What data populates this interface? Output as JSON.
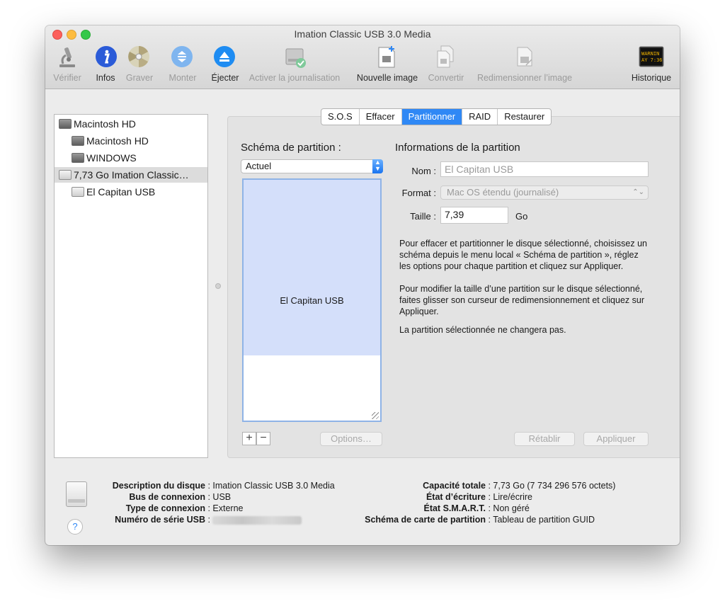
{
  "window": {
    "title": "Imation Classic USB 3.0 Media"
  },
  "toolbar": {
    "verify_label": "Vérifier",
    "info_label": "Infos",
    "burn_label": "Graver",
    "mount_label": "Monter",
    "eject_label": "Éjecter",
    "journal_label": "Activer la journalisation",
    "new_image_label": "Nouvelle image",
    "convert_label": "Convertir",
    "resize_image_label": "Redimensionner l’image",
    "history_label": "Historique",
    "log_icon_text_1": "WARNIN",
    "log_icon_text_2": "AY 7:36"
  },
  "sidebar": {
    "items": [
      {
        "label": "Macintosh HD"
      },
      {
        "label": "Macintosh HD"
      },
      {
        "label": "WINDOWS"
      },
      {
        "label": "7,73 Go Imation Classic…"
      },
      {
        "label": "El Capitan USB"
      }
    ]
  },
  "tabs": {
    "items": [
      {
        "label": "S.O.S"
      },
      {
        "label": "Effacer"
      },
      {
        "label": "Partitionner"
      },
      {
        "label": "RAID"
      },
      {
        "label": "Restaurer"
      }
    ],
    "active": "Partitionner"
  },
  "partition": {
    "scheme_title": "Schéma de partition :",
    "scheme_value": "Actuel",
    "map_partition_label": "El Capitan USB",
    "add_label": "+",
    "remove_label": "−",
    "options_label": "Options…",
    "info_title": "Informations de la partition",
    "name_label": "Nom :",
    "name_value": "El Capitan USB",
    "format_label": "Format :",
    "format_value": "Mac OS étendu (journalisé)",
    "size_label": "Taille :",
    "size_value": "7,39",
    "size_unit": "Go",
    "help_1": "Pour effacer et partitionner le disque sélectionné, choisissez un schéma depuis le menu local « Schéma de partition », réglez les options pour chaque partition et cliquez sur Appliquer.",
    "help_2": "Pour modifier la taille d’une partition sur le disque sélectionné, faites glisser son curseur de redimensionnement et cliquez sur Appliquer.",
    "help_3": "La partition sélectionnée ne changera pas.",
    "revert_label": "Rétablir",
    "apply_label": "Appliquer"
  },
  "disk_info": {
    "description_key": "Description du disque",
    "description_value": "Imation Classic USB 3.0 Media",
    "bus_key": "Bus de connexion",
    "bus_value": "USB",
    "conn_type_key": "Type de connexion",
    "conn_type_value": "Externe",
    "serial_key": "Numéro de série USB",
    "capacity_key": "Capacité totale",
    "capacity_value": "7,73 Go (7 734 296 576 octets)",
    "write_key": "État d’écriture",
    "write_value": "Lire/écrire",
    "smart_key": "État S.M.A.R.T.",
    "smart_value": "Non géré",
    "map_key": "Schéma de carte de partition",
    "map_value": "Tableau de partition GUID",
    "help_glyph": "?"
  }
}
